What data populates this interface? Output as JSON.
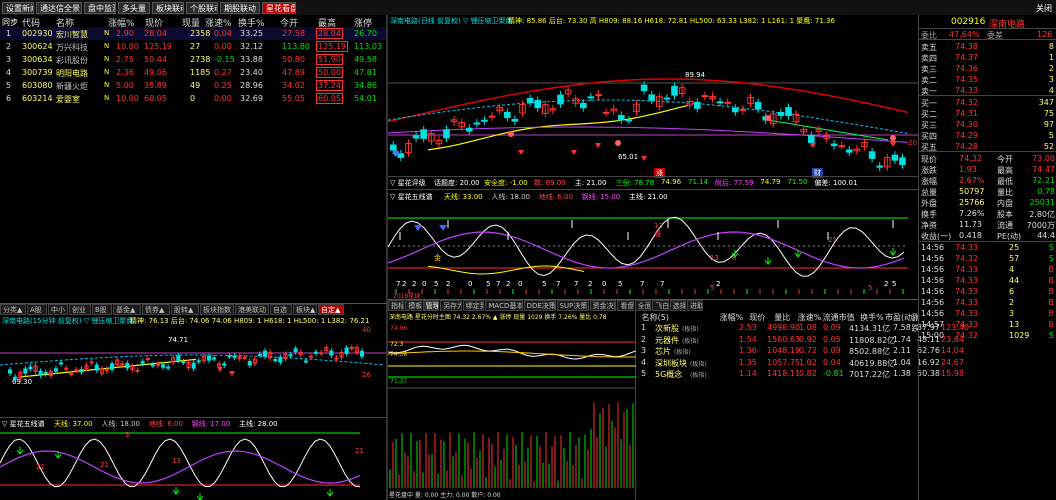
{
  "top_tabs": [
    "设置新闻",
    "通达信全景",
    "盘中监测",
    "多头量",
    "板块联动",
    "个股联动",
    "期股联动",
    "星花看盘"
  ],
  "top_right_label": "关闭",
  "sidebar_left": "同步",
  "stock_table": {
    "headers": [
      "代码",
      "名称",
      "涨幅%",
      "现价",
      "现量",
      "涨速%",
      "换手%",
      "今开",
      "最高",
      "涨停"
    ],
    "rows": [
      {
        "idx": "1",
        "code": "002930",
        "name": "宏川智慧",
        "flag": "N",
        "pct": "2.90",
        "price": "28.04",
        "vol": "2358",
        "speed": "0.04",
        "turn": "33.25",
        "open": "27.58",
        "high": "28.04",
        "limit": "26.70"
      },
      {
        "idx": "2",
        "code": "300624",
        "name": "万兴科技",
        "flag": "N",
        "pct": "10.00",
        "price": "125.19",
        "vol": "27",
        "speed": "0.00",
        "turn": "32.12",
        "open": "113.80",
        "high": "125.19",
        "limit": "113.03"
      },
      {
        "idx": "3",
        "code": "300634",
        "name": "彩讯股份",
        "flag": "N",
        "pct": "2.75",
        "price": "50.44",
        "vol": "2738",
        "speed": "-0.15",
        "turn": "33.88",
        "open": "50.80",
        "high": "51.90",
        "limit": "49.58"
      },
      {
        "idx": "4",
        "code": "300739",
        "name": "明阳电路",
        "flag": "N",
        "pct": "2.36",
        "price": "49.06",
        "vol": "1185",
        "speed": "0.27",
        "turn": "23.40",
        "open": "47.89",
        "high": "50.00",
        "limit": "47.81"
      },
      {
        "idx": "5",
        "code": "603080",
        "name": "新疆火炬",
        "flag": "N",
        "pct": "5.00",
        "price": "35.89",
        "vol": "49",
        "speed": "0.25",
        "turn": "28.96",
        "open": "34.02",
        "high": "37.24",
        "limit": "34.86"
      },
      {
        "idx": "6",
        "code": "603214",
        "name": "爱婴室",
        "flag": "N",
        "pct": "10.00",
        "price": "60.05",
        "vol": "0",
        "speed": "0.00",
        "turn": "32.69",
        "open": "55.05",
        "high": "60.05",
        "limit": "54.01"
      }
    ]
  },
  "bottom_left_tabs": [
    "分类▲",
    "A股",
    "中小",
    "创业",
    "B股",
    "基金▲",
    "债券▲",
    "股转▲",
    "板块指数",
    "港美联动",
    "自选",
    "板块▲",
    "自定▲"
  ],
  "mini_chart": {
    "title": "深南电路(15分钟 前复权) ▽ 锂压缩卫聚鹰",
    "info": "精神: 76.13  后台: 74.06  74.06 H809: 1 H618: 1 HL500: 1 L382: 76.21",
    "labels": {
      "high": "74.71",
      "low": "69.30",
      "r1": "40",
      "r2": "26"
    },
    "ind_title": "▽ 星花五线谱",
    "ind_items": [
      "天线: 37.00",
      "人线: 18.00",
      "地线: 6.00",
      "钢线: 17.00",
      "主线: 28.00"
    ],
    "ind_marks": [
      "21",
      "21",
      "3",
      "13",
      "21"
    ]
  },
  "main_chart": {
    "title": "深南电路(日线 前复权) ▽ 锂压缩卫聚鹰",
    "info": "精神: 85.86  后台: 73.30  高  H809: 88.16  H618: 72.81  HL500: 63.33  L382: 1  L161: 1  聚鹰: 71.36",
    "hi_label": "89.94",
    "lo_label": "65.01",
    "right_label": "20",
    "bottom_tags": [
      "涨",
      "财"
    ],
    "ind1_title": "▽ 星花评级",
    "ind1_items": [
      "话题度: 20.00",
      "安全度: -1.00",
      "数: 89.00",
      "主: 21.00",
      "三份: 78.78",
      "74.96",
      "71.14",
      "附后: 77.59",
      "74.79",
      "71.50",
      "偏差: 100.01"
    ],
    "ind2_title": "▽ 星花五线谱",
    "ind2_items": [
      "天线: 33.00",
      "人线: 18.00",
      "地线: 6.00",
      "钢线: 15.00",
      "主线: 21.00"
    ],
    "digit_row": [
      "7",
      "2",
      "2",
      "0",
      "5",
      "2",
      "0",
      "5",
      "7",
      "2",
      "0",
      "5",
      "7",
      "7",
      "2",
      "0",
      "5",
      "7",
      "7",
      "2",
      "2",
      "5"
    ],
    "ind2_marks": [
      "金",
      "涨",
      "13",
      "13",
      "8",
      "21",
      "5",
      "5"
    ],
    "ind2_footer": "2018星球"
  },
  "sub_tabs": [
    "指标",
    "模板",
    "管理",
    "另存为",
    "绑定到",
    "MACD基本",
    "DDE决策",
    "SUP决策",
    "资金决策",
    "看盘",
    "全面",
    "飞白",
    "选择",
    "进取"
  ],
  "intraday": {
    "title": "深南电路  星花分时主图  74.32  2.67%  ▲ 涨停  现量 1029  换手 7.26%  量比 0.78",
    "prices": [
      "74.96",
      "72.3",
      "74.38",
      "71.37"
    ],
    "footer": "星花盘中  量: 0.00  主力: 0.00  散户: 0.00"
  },
  "sector_table": {
    "headers": [
      "名称(5)",
      "涨幅%",
      "现价",
      "量比",
      "涨速%",
      "流通市值",
      "换手%",
      "市盈(动)",
      "涨跌"
    ],
    "rows": [
      {
        "idx": "1",
        "name": "次新股",
        "sub": "(板指)",
        "pct": "2.53",
        "price": "4998.90",
        "vr": "1.08",
        "speed": "0.09",
        "cap": "4134.31亿",
        "turn": "7.58",
        "pe": "37.97",
        "chg": "123.40"
      },
      {
        "idx": "2",
        "name": "元器件",
        "sub": "(板指)",
        "pct": "1.54",
        "price": "1560.63",
        "vr": "0.92",
        "speed": "0.05",
        "cap": "11808.82亿",
        "turn": "1.74",
        "pe": "48.11",
        "chg": "23.64"
      },
      {
        "idx": "3",
        "name": "芯片",
        "sub": "(板指)",
        "pct": "1.36",
        "price": "1048.19",
        "vr": "0.72",
        "speed": "0.09",
        "cap": "8502.88亿",
        "turn": "2.11",
        "pe": "62.76",
        "chg": "14.04"
      },
      {
        "idx": "4",
        "name": "深圳板块",
        "sub": "(板指)",
        "pct": "1.35",
        "price": "1057.75",
        "vr": "1.02",
        "speed": "0.04",
        "cap": "40619.88亿",
        "turn": "1.04",
        "pe": "16.92",
        "chg": "24.67"
      },
      {
        "idx": "5",
        "name": "5G概念",
        "sub": "(板指)",
        "pct": "1.14",
        "price": "1418.11",
        "vr": "0.82",
        "speed": "-0.81",
        "cap": "7017.22亿",
        "turn": "1.38",
        "pe": "50.38",
        "chg": "15.98"
      }
    ]
  },
  "quote": {
    "code": "002916",
    "name": "深南电路",
    "weibi_label": "委比",
    "weibi": "47.64%",
    "weicha_label": "委差",
    "weicha": "126",
    "asks": [
      {
        "label": "卖五",
        "price": "74.38",
        "vol": "8"
      },
      {
        "label": "卖四",
        "price": "74.37",
        "vol": "1"
      },
      {
        "label": "卖三",
        "price": "74.36",
        "vol": "2"
      },
      {
        "label": "卖二",
        "price": "74.35",
        "vol": "3"
      },
      {
        "label": "卖一",
        "price": "74.33",
        "vol": "4"
      }
    ],
    "bids": [
      {
        "label": "买一",
        "price": "74.32",
        "vol": "347"
      },
      {
        "label": "买二",
        "price": "74.31",
        "vol": "75"
      },
      {
        "label": "买三",
        "price": "74.30",
        "vol": "97"
      },
      {
        "label": "买四",
        "price": "74.29",
        "vol": "5"
      },
      {
        "label": "买五",
        "price": "74.28",
        "vol": "52"
      }
    ],
    "stats": [
      {
        "l1": "现价",
        "v1": "74.32",
        "l2": "今开",
        "v2": "73.00"
      },
      {
        "l1": "涨跌",
        "v1": "1.93",
        "l2": "最高",
        "v2": "74.47"
      },
      {
        "l1": "涨幅",
        "v1": "2.67%",
        "l2": "最低",
        "v2": "72.21"
      },
      {
        "l1": "总量",
        "v1": "50797",
        "l2": "量比",
        "v2": "0.78"
      },
      {
        "l1": "外盘",
        "v1": "25766",
        "l2": "内盘",
        "v2": "25031"
      },
      {
        "l1": "换手",
        "v1": "7.26%",
        "l2": "股本",
        "v2": "2.80亿"
      },
      {
        "l1": "净资",
        "v1": "11.73",
        "l2": "流通",
        "v2": "7000万"
      },
      {
        "l1": "收益(一)",
        "v1": "0.418",
        "l2": "PE(动)",
        "v2": "44.4"
      }
    ],
    "ticks": [
      {
        "time": "14:56",
        "price": "74.33",
        "vol": "25",
        "dir": "S"
      },
      {
        "time": "14:56",
        "price": "74.32",
        "vol": "57",
        "dir": "S"
      },
      {
        "time": "14:56",
        "price": "74.33",
        "vol": "4",
        "dir": "B"
      },
      {
        "time": "14:56",
        "price": "74.33",
        "vol": "44",
        "dir": "B"
      },
      {
        "time": "14:56",
        "price": "74.33",
        "vol": "6",
        "dir": "B"
      },
      {
        "time": "14:56",
        "price": "74.33",
        "vol": "2",
        "dir": "B"
      },
      {
        "time": "14:56",
        "price": "74.33",
        "vol": "3",
        "dir": "B"
      },
      {
        "time": "14:57",
        "price": "74.33",
        "vol": "13",
        "dir": "B"
      },
      {
        "time": "15:00",
        "price": "74.32",
        "vol": "1029",
        "dir": "S"
      }
    ]
  }
}
